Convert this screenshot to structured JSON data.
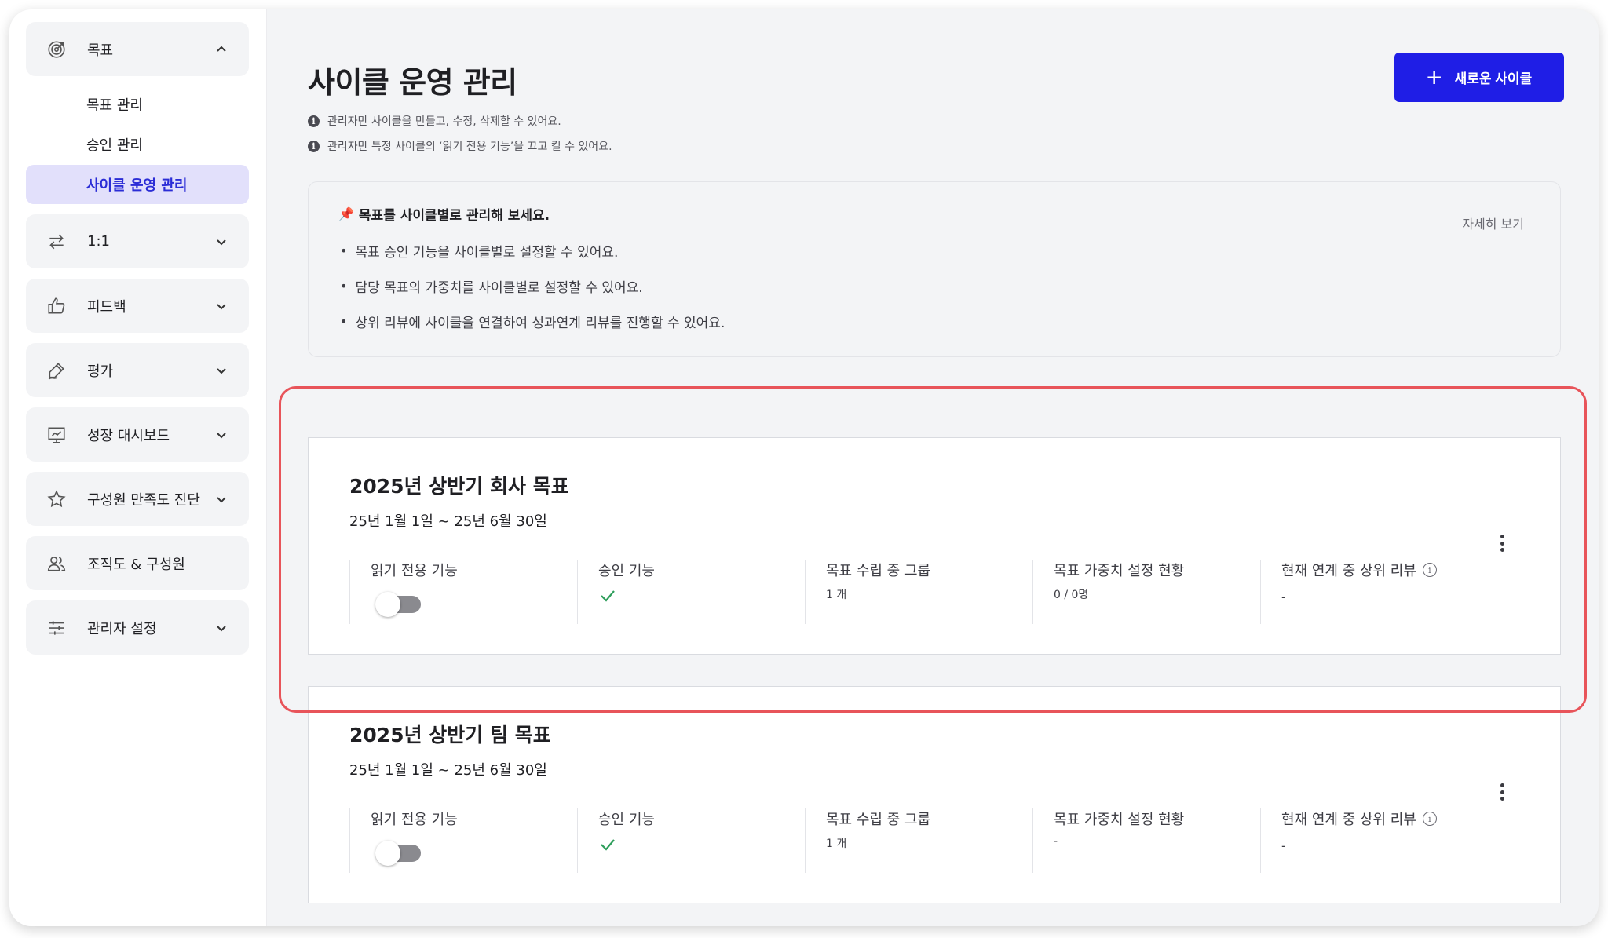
{
  "sidebar": {
    "goal": {
      "label": "목표",
      "icon": "target-icon"
    },
    "sub_items": [
      {
        "label": "목표 관리"
      },
      {
        "label": "승인 관리"
      },
      {
        "label": "사이클 운영 관리"
      }
    ],
    "groups": [
      {
        "label": "1:1",
        "icon": "swap-arrows-icon"
      },
      {
        "label": "피드백",
        "icon": "thumbs-up-icon"
      },
      {
        "label": "평가",
        "icon": "pen-icon"
      },
      {
        "label": "성장 대시보드",
        "icon": "presentation-chart-icon"
      },
      {
        "label": "구성원 만족도 진단",
        "icon": "star-icon"
      },
      {
        "label": "조직도 & 구성원",
        "icon": "users-icon"
      },
      {
        "label": "관리자 설정",
        "icon": "sliders-icon"
      }
    ]
  },
  "header": {
    "title": "사이클 운영 관리",
    "notes": [
      "관리자만 사이클을 만들고, 수정, 삭제할 수 있어요.",
      "관리자만 특정 사이클의 ‘읽기 전용 기능’을 끄고 킬 수 있어요."
    ],
    "new_button": "새로운 사이클"
  },
  "info_box": {
    "title": "목표를 사이클별로 관리해 보세요.",
    "items": [
      "목표 승인 기능을 사이클별로 설정할 수 있어요.",
      "담당 목표의 가중치를 사이클별로 설정할 수 있어요.",
      "상위 리뷰에 사이클을 연결하여 성과연계 리뷰를 진행할 수 있어요."
    ],
    "more_link": "자세히 보기"
  },
  "column_labels": {
    "read_only": "읽기 전용 기능",
    "approval": "승인 기능",
    "goal_groups": "목표 수립 중 그룹",
    "weight_status": "목표 가중치 설정 현황",
    "linked_review": "현재 연계 중 상위 리뷰"
  },
  "cycles": [
    {
      "title": "2025년 상반기 회사 목표",
      "period": "25년 1월 1일 ~ 25년 6월 30일",
      "read_only_enabled": false,
      "approval_enabled": true,
      "goal_groups": "1 개",
      "weight_status": "0 / 0명",
      "linked_review": "-"
    },
    {
      "title": "2025년 상반기 팀 목표",
      "period": "25년 1월 1일 ~ 25년 6월 30일",
      "read_only_enabled": false,
      "approval_enabled": true,
      "goal_groups": "1 개",
      "weight_status": "-",
      "linked_review": "-"
    }
  ],
  "colors": {
    "accent": "#1f1ee6",
    "active_nav_bg": "#e2e0fb",
    "active_nav_text": "#2b2dd6",
    "highlight_border": "#e8545a",
    "check": "#2e9e5b"
  }
}
